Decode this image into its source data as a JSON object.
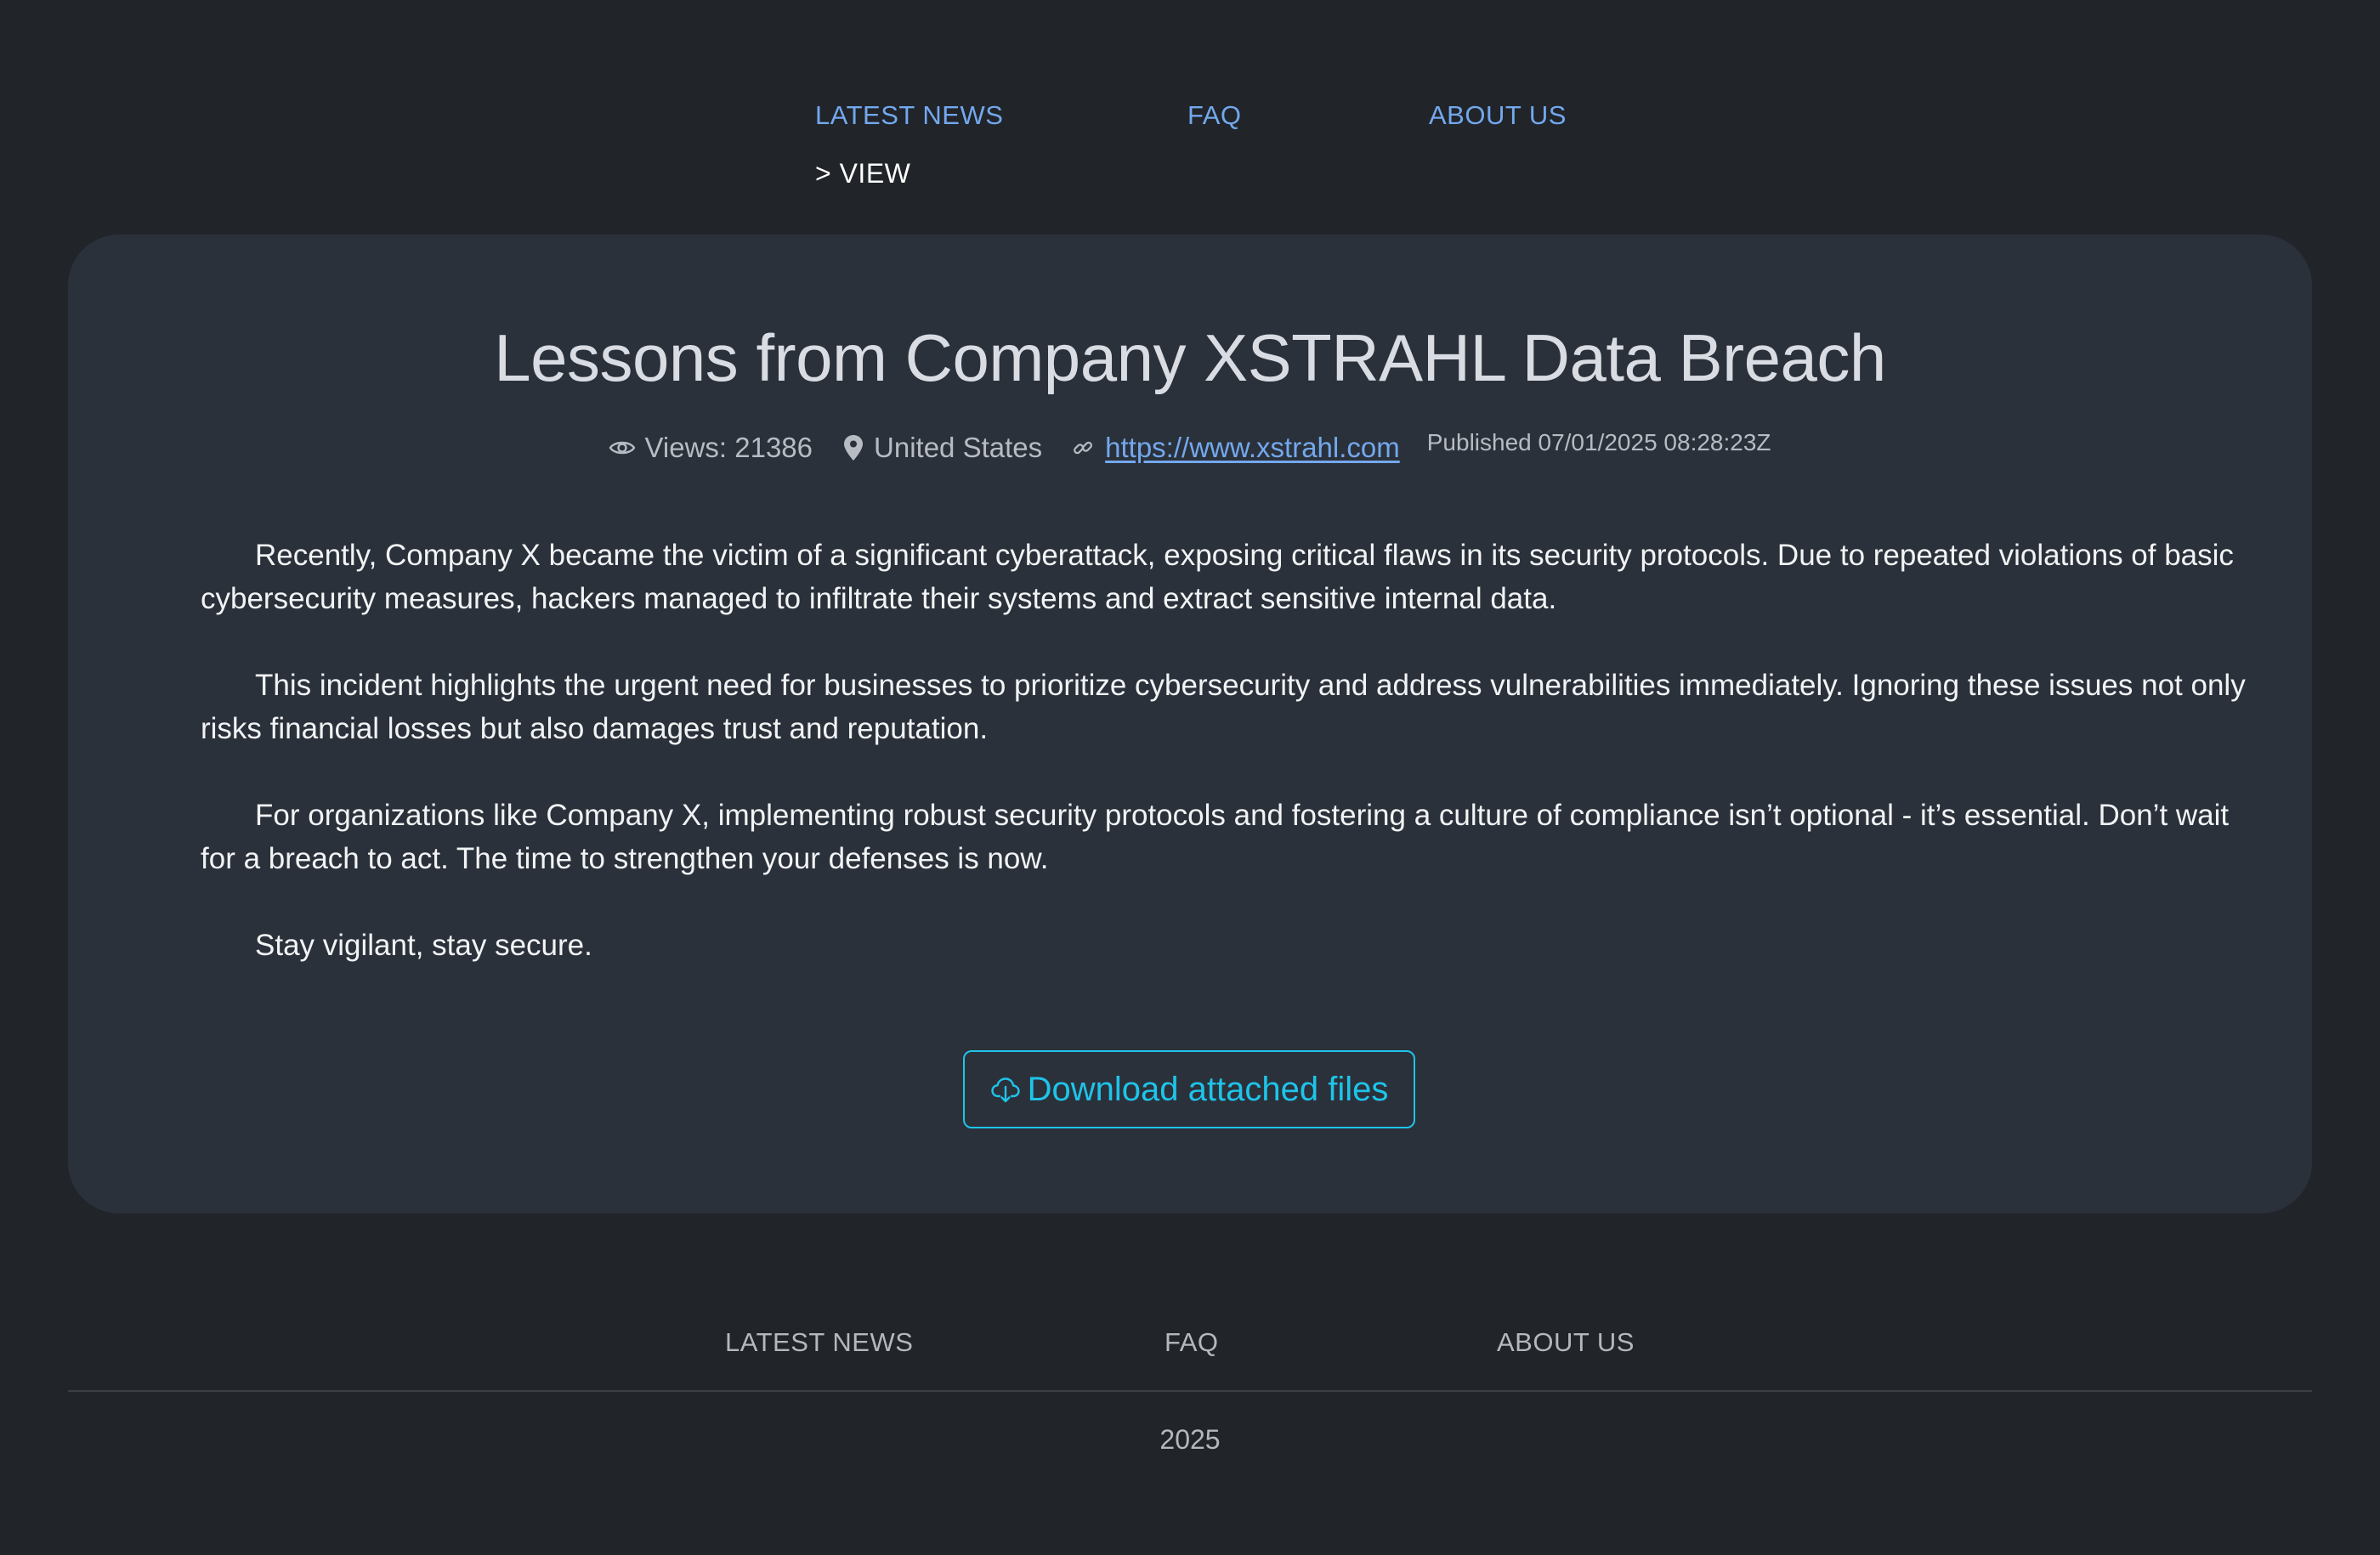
{
  "nav": {
    "items": [
      {
        "label": "LATEST NEWS"
      },
      {
        "label": "FAQ"
      },
      {
        "label": "ABOUT US"
      }
    ],
    "breadcrumb": "> VIEW"
  },
  "article": {
    "title": "Lessons from Company XSTRAHL Data Breach",
    "views": "Views: 21386",
    "location": "United States",
    "url": "https://www.xstrahl.com",
    "published": "Published 07/01/2025 08:28:23Z",
    "paragraphs": [
      "Recently, Company X became the victim of a significant cyberattack, exposing critical flaws in its security protocols. Due to repeated violations of basic cybersecurity measures, hackers managed to infiltrate their systems and extract sensitive internal data.",
      "This incident highlights the urgent need for businesses to prioritize cybersecurity and address vulnerabilities immediately. Ignoring these issues not only risks financial losses but also damages trust and reputation.",
      "For organizations like Company X, implementing robust security protocols and fostering a culture of compliance isn’t optional - it’s essential. Don’t wait for a breach to act. The time to strengthen your defenses is now.",
      "Stay vigilant, stay secure."
    ],
    "download_label": "Download attached files"
  },
  "footer": {
    "items": [
      {
        "label": "LATEST NEWS"
      },
      {
        "label": "FAQ"
      },
      {
        "label": "ABOUT US"
      }
    ],
    "year": "2025"
  },
  "icons": {
    "views": "eye-icon",
    "location": "map-pin-icon",
    "link": "link-icon",
    "download": "cloud-download-icon"
  },
  "colors": {
    "background": "#212429",
    "card": "#2b313a",
    "link": "#73a8ee",
    "accent": "#1ec4ea",
    "muted_text": "#b3b8be"
  }
}
